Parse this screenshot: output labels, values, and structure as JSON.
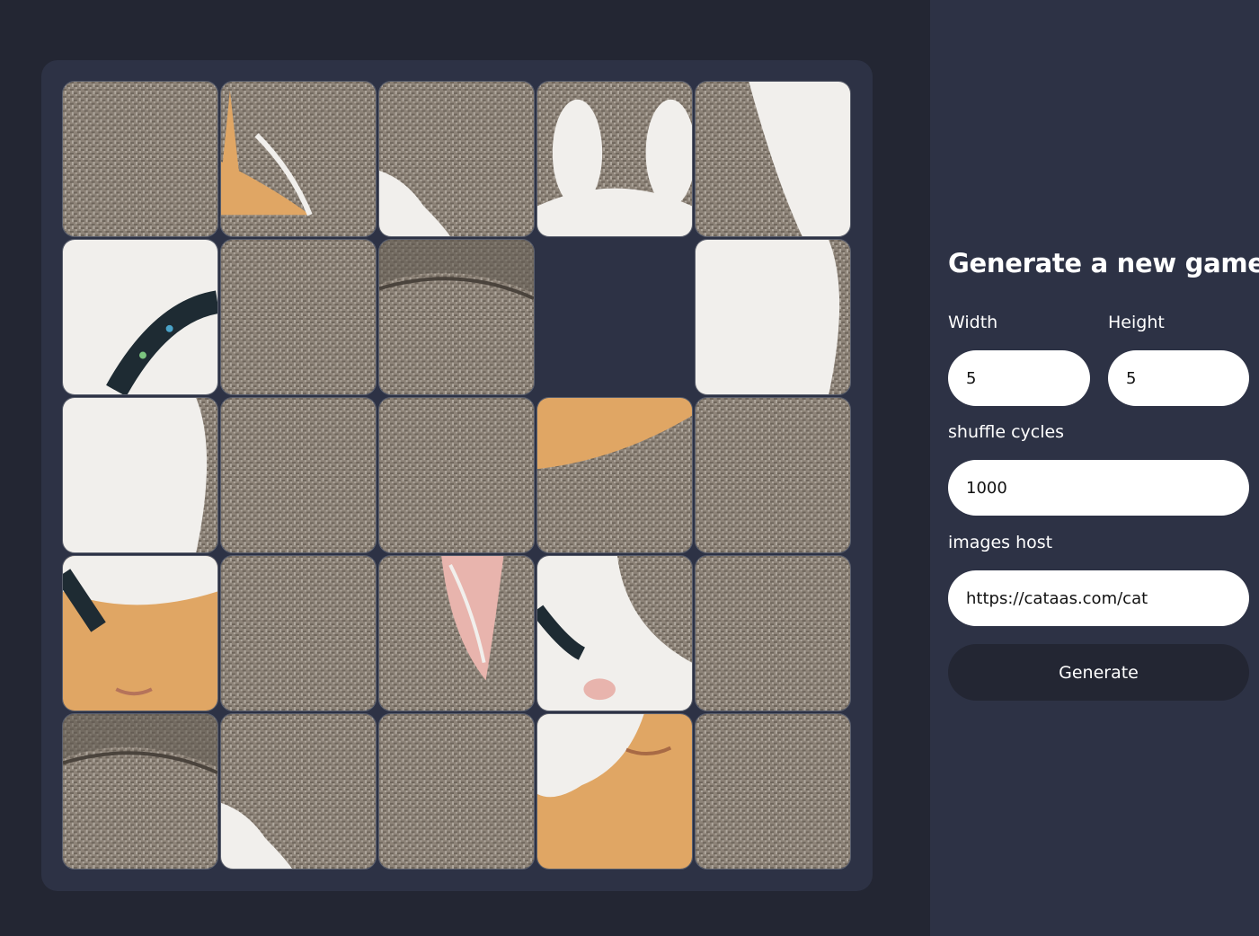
{
  "game": {
    "grid": {
      "columns": 5,
      "rows": 5
    },
    "empty_slot": {
      "row": 1,
      "col": 3
    },
    "colors": {
      "page_bg": "#232633",
      "board_bg": "#2d3245",
      "fabric": "#8d8378",
      "fur_white": "#f1efec",
      "fur_orange": "#e0a664",
      "collar": "#1e2b33",
      "ear_pink": "#e8b4ad"
    },
    "tiles": [
      {
        "row": 0,
        "col": 0,
        "content": "fabric-texture"
      },
      {
        "row": 0,
        "col": 1,
        "content": "orange-ear-tip"
      },
      {
        "row": 0,
        "col": 2,
        "content": "white-fur-corner"
      },
      {
        "row": 0,
        "col": 3,
        "content": "two-white-paws"
      },
      {
        "row": 0,
        "col": 4,
        "content": "white-paw-edge"
      },
      {
        "row": 1,
        "col": 0,
        "content": "white-fur-collar"
      },
      {
        "row": 1,
        "col": 1,
        "content": "fabric-texture"
      },
      {
        "row": 1,
        "col": 2,
        "content": "sofa-cushion"
      },
      {
        "row": 1,
        "col": 4,
        "content": "white-fur-body"
      },
      {
        "row": 2,
        "col": 0,
        "content": "white-fur-body"
      },
      {
        "row": 2,
        "col": 1,
        "content": "fabric-texture"
      },
      {
        "row": 2,
        "col": 2,
        "content": "fabric-texture"
      },
      {
        "row": 2,
        "col": 3,
        "content": "orange-fur-top"
      },
      {
        "row": 2,
        "col": 4,
        "content": "fabric-texture"
      },
      {
        "row": 3,
        "col": 0,
        "content": "orange-head-collar"
      },
      {
        "row": 3,
        "col": 1,
        "content": "fabric-texture"
      },
      {
        "row": 3,
        "col": 2,
        "content": "pink-ear"
      },
      {
        "row": 3,
        "col": 3,
        "content": "white-muzzle"
      },
      {
        "row": 3,
        "col": 4,
        "content": "fabric-texture"
      },
      {
        "row": 4,
        "col": 0,
        "content": "sofa-cushion"
      },
      {
        "row": 4,
        "col": 1,
        "content": "white-fur-corner"
      },
      {
        "row": 4,
        "col": 2,
        "content": "fabric-texture"
      },
      {
        "row": 4,
        "col": 3,
        "content": "orange-face"
      },
      {
        "row": 4,
        "col": 4,
        "content": "fabric-texture"
      }
    ]
  },
  "panel": {
    "title": "Generate a new game",
    "width_label": "Width",
    "width_value": "5",
    "height_label": "Height",
    "height_value": "5",
    "shuffle_label": "shuffle cycles",
    "shuffle_value": "1000",
    "host_label": "images host",
    "host_value": "https://cataas.com/cat",
    "generate_label": "Generate"
  }
}
